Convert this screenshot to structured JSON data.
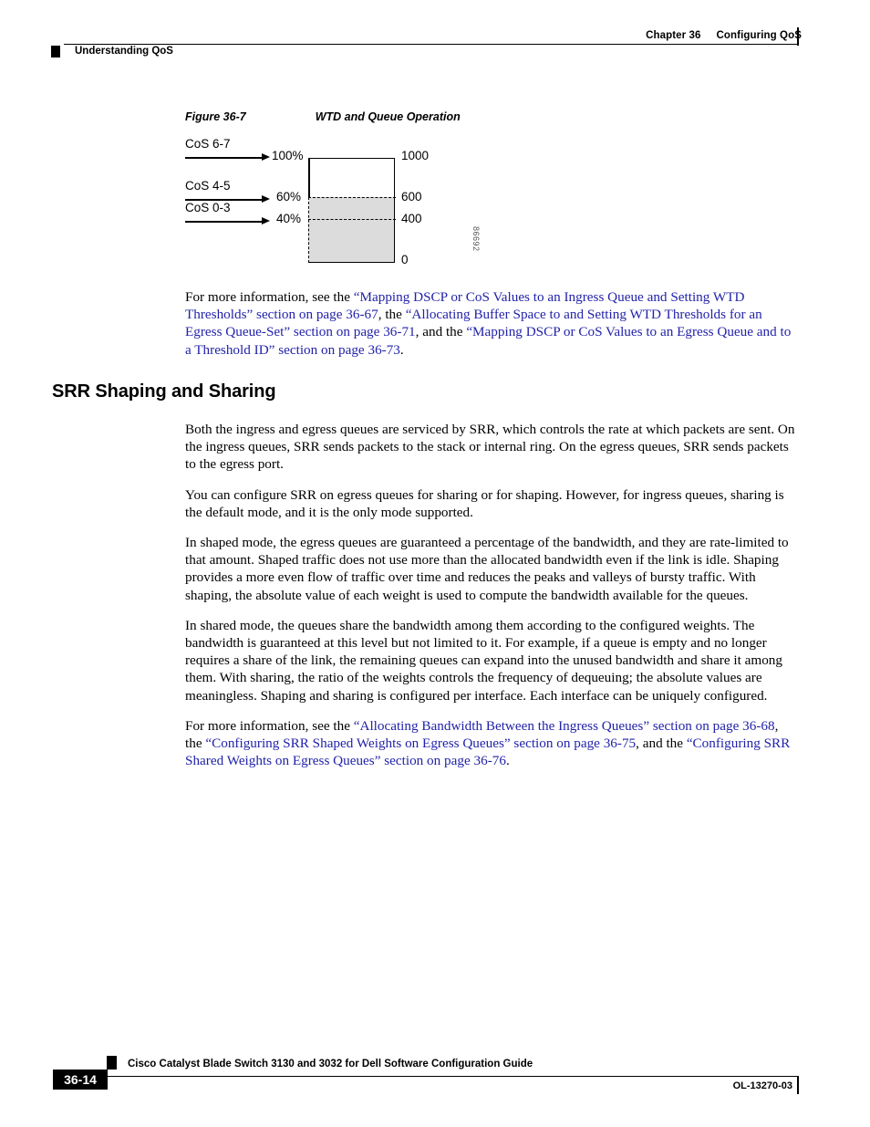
{
  "header": {
    "chapter_number": "Chapter 36",
    "chapter_title": "Configuring QoS",
    "section_title": "Understanding QoS"
  },
  "figure": {
    "number": "Figure 36-7",
    "title": "WTD and Queue Operation",
    "graphic_id": "86692",
    "cos_rows": [
      {
        "label": "CoS 6-7",
        "percent": "100%",
        "value": "1000"
      },
      {
        "label": "CoS 4-5",
        "percent": "60%",
        "value": "600"
      },
      {
        "label": "CoS 0-3",
        "percent": "40%",
        "value": "400"
      }
    ],
    "baseline_value": "0",
    "fill_color": "#dcdcdc"
  },
  "content": {
    "figure_refs_intro": "For more information, see the ",
    "para_figrefs": [
      {
        "t": "For more information, see the ",
        "link": false
      },
      {
        "t": "“Mapping DSCP or CoS Values to an Ingress Queue and Setting WTD Thresholds” section on page 36-67",
        "link": true
      },
      {
        "t": ", the ",
        "link": false
      },
      {
        "t": "“Allocating Buffer Space to and Setting WTD Thresholds for an Egress Queue-Set” section on page 36-71",
        "link": true
      },
      {
        "t": ", and the ",
        "link": false
      },
      {
        "t": "“Mapping DSCP or CoS Values to an Egress Queue and to a Threshold ID” section on page 36-73",
        "link": true
      },
      {
        "t": ".",
        "link": false
      }
    ],
    "section_heading": "SRR Shaping and Sharing",
    "para1": "Both the ingress and egress queues are serviced by SRR, which controls the rate at which packets are sent. On the ingress queues, SRR sends packets to the stack or internal ring. On the egress queues, SRR sends packets to the egress port.",
    "para2": "You can configure SRR on egress queues for sharing or for shaping. However, for ingress queues, sharing is the default mode, and it is the only mode supported.",
    "para3": "In shaped mode, the egress queues are guaranteed a percentage of the bandwidth, and they are rate-limited to that amount. Shaped traffic does not use more than the allocated bandwidth even if the link is idle. Shaping provides a more even flow of traffic over time and reduces the peaks and valleys of bursty traffic. With shaping, the absolute value of each weight is used to compute the bandwidth available for the queues.",
    "para4": "In shared mode, the queues share the bandwidth among them according to the configured weights. The bandwidth is guaranteed at this level but not limited to it. For example, if a queue is empty and no longer requires a share of the link, the remaining queues can expand into the unused bandwidth and share it among them. With sharing, the ratio of the weights controls the frequency of dequeuing; the absolute values are meaningless. Shaping and sharing is configured per interface. Each interface can be uniquely configured.",
    "para_srrrefs": [
      {
        "t": "For more information, see the ",
        "link": false
      },
      {
        "t": "“Allocating Bandwidth Between the Ingress Queues” section on page 36-68",
        "link": true
      },
      {
        "t": ", the ",
        "link": false
      },
      {
        "t": "“Configuring SRR Shaped Weights on Egress Queues” section on page 36-75",
        "link": true
      },
      {
        "t": ", and the ",
        "link": false
      },
      {
        "t": "“Configuring SRR Shared Weights on Egress Queues” section on page 36-76",
        "link": true
      },
      {
        "t": ".",
        "link": false
      }
    ]
  },
  "footer": {
    "doc_title": "Cisco Catalyst Blade Switch 3130 and 3032 for Dell Software Configuration Guide",
    "page_number": "36-14",
    "doc_id": "OL-13270-03"
  },
  "colors": {
    "link": "#2222aa",
    "text": "#000000",
    "fill_gray": "#dcdcdc"
  }
}
